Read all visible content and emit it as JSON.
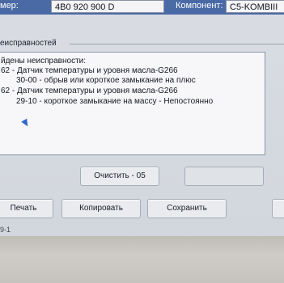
{
  "header": {
    "number_label": "мер:",
    "number_value": "4B0 920 900 D",
    "component_label": "Компонент:",
    "component_value": "C5-KOMBIII"
  },
  "group": {
    "title": "еисправностей"
  },
  "faults": {
    "lines": [
      "йдены неисправности:",
      "62 -   Датчик температуры и уровня масла-G266",
      "30-00 -   обрыв или короткое замыкание на плюс",
      "62 -   Датчик температуры и уровня масла-G266",
      "29-10 -   короткое замыкание на массу - Непостоянно"
    ]
  },
  "buttons": {
    "clear": "Очистить - 05",
    "print": "Печать",
    "copy": "Копировать",
    "save": "Сохранить"
  },
  "status": {
    "text": "9-1"
  }
}
